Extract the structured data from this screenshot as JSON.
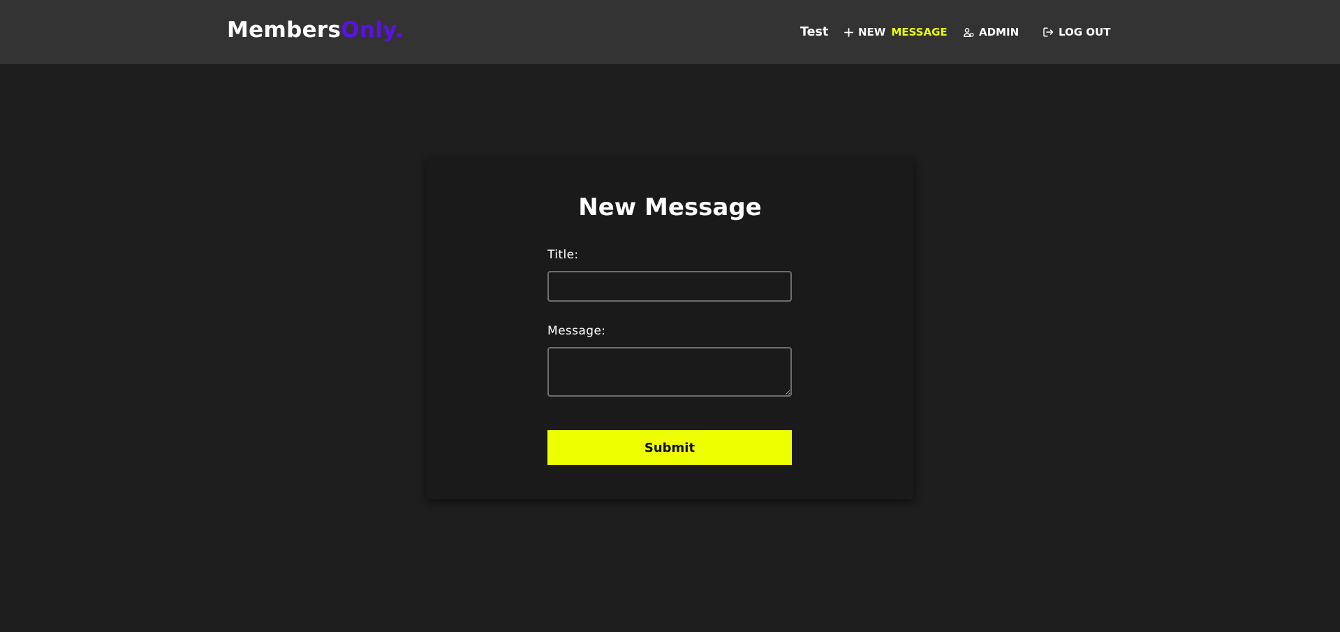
{
  "brand": {
    "name": "Members",
    "accent": "Only."
  },
  "nav": {
    "user": "Test",
    "new_label": "NEW",
    "new_highlight": "MESSAGE",
    "admin": "ADMIN",
    "logout": "LOG OUT",
    "icons": {
      "new": "plus-icon",
      "admin": "user-admin-icon",
      "logout": "logout-icon"
    }
  },
  "form": {
    "heading": "New Message",
    "title_label": "Title:",
    "title_value": "",
    "message_label": "Message:",
    "message_value": "",
    "submit_label": "Submit"
  },
  "colors": {
    "page_bg": "#1e1e1e",
    "topbar_bg": "#333333",
    "card_bg": "#1a1a1a",
    "brand_accent": "#5c10e8",
    "highlight": "#eeff00"
  }
}
